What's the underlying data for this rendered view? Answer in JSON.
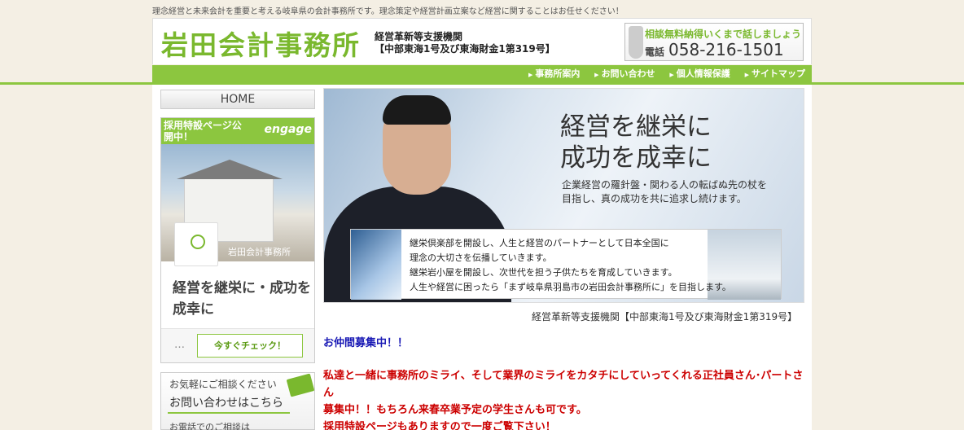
{
  "top_tagline": "理念経営と未来会計を重要と考える岐阜県の会計事務所です。理念策定や経営計画立案など経営に関することはお任せください！",
  "header": {
    "logo": "岩田会計事務所",
    "sub_line1": "経営革新等支援機関",
    "sub_line2": "【中部東海1号及び東海財金1第319号】",
    "phone_tagline": "相談無料納得いくまで話しましょう",
    "phone_label": "電話",
    "phone_number": "058-216-1501"
  },
  "nav": {
    "items": [
      {
        "label": "事務所案内"
      },
      {
        "label": "お問い合わせ"
      },
      {
        "label": "個人情報保護"
      },
      {
        "label": "サイトマップ"
      }
    ]
  },
  "sidebar": {
    "home": "HOME",
    "engage": {
      "head_text": "採用特設ページ公開中！",
      "brand": "engage",
      "company": "岩田会計事務所",
      "catch": "経営を継栄に・成功を成幸に",
      "dots": "…",
      "button": "今すぐチェック！"
    },
    "contact": {
      "line1": "お気軽にご相談ください",
      "line2": "お問い合わせはこちら",
      "line3": "お電話でのご相談は"
    }
  },
  "hero": {
    "title_line1": "経営を継栄に",
    "title_line2": "成功を成幸に",
    "sub_line1": "企業経営の羅針盤・関わる人の転ばぬ先の杖を",
    "sub_line2": "目指し、真の成功を共に追求し続けます。",
    "box_lines": [
      "継栄倶楽部を開設し、人生と経営のパートナーとして日本全国に",
      "理念の大切さを伝播していきます。",
      "継栄岩小屋を開設し、次世代を担う子供たちを育成していきます。",
      "人生や経営に困ったら「まず岐阜県羽島市の岩田会計事務所に」を目指します。"
    ]
  },
  "caption": "経営革新等支援機関【中部東海1号及び東海財金1第319号】",
  "recruit": {
    "heading": "お仲間募集中！！",
    "body_line1": "私達と一緒に事務所のミライ、そして業界のミライをカタチにしていってくれる正社員さん･パートさん",
    "body_line2": "募集中！！もちろん来春卒業予定の学生さんも可です。",
    "body_line3": "採用特設ページもありますので一度ご覧下さい！"
  }
}
